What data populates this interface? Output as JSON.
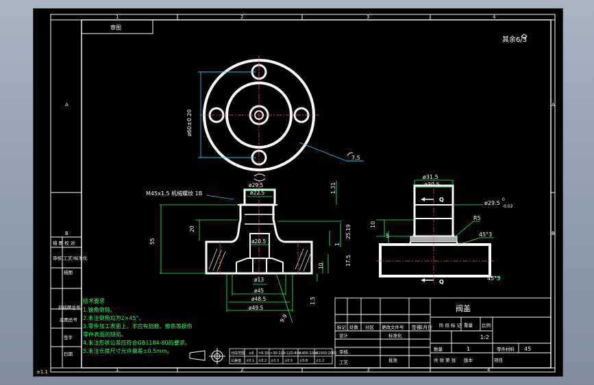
{
  "sheet": {
    "zone_columns": [
      "1",
      "2",
      "3",
      "4"
    ],
    "zone_rows": [
      "A",
      "B"
    ],
    "sheet_count": "其余6/3",
    "scale_note": "±1.1"
  },
  "top_left_box": "审图",
  "left_strip": {
    "labels": [
      "描 图 校 对",
      "审核(工艺)标准化",
      "描图",
      "旧底图总号",
      "底图总号",
      "签字",
      "日期"
    ]
  },
  "views": {
    "top_dia": "ø60±0.20",
    "top_hole": "7.5",
    "thread": "M45x1.5 机械螺纹 1B",
    "front": {
      "dims": [
        "ø29.5",
        "ø22.5",
        "ø20.5",
        "ø13",
        "ø45",
        "ø48.5",
        "ø49.5"
      ],
      "heights": [
        "1.31",
        "20",
        "55",
        "25.19",
        "17.5",
        "1",
        "10",
        "1.5",
        "9.9"
      ]
    },
    "side": {
      "dims": [
        "ø31.5",
        "ø30.5",
        "ø29.5",
        "0",
        "-0.02"
      ],
      "marks": [
        "Q",
        "Q",
        "R5",
        "45°3",
        "45°3",
        "10",
        "5"
      ]
    }
  },
  "tech_requirements": {
    "title": "技术要求",
    "items": [
      "1.锐角倒钝。",
      "2.未注倒角均为2×45°。",
      "3.零件加工表面上，不应有划痕、擦伤等损伤",
      "零件表面的缺陷。",
      "4.未注形状公差应符合GB1184-80的要求。",
      "5.未注长度尺寸允许偏差±0.5mm。"
    ]
  },
  "tolerance_table": {
    "row1": [
      "分段范围",
      "≤6",
      ">6-30",
      ">30-120",
      ">120-400",
      ">400-1000",
      ">1000-2000"
    ],
    "row2": [
      "公差值",
      "±0.1",
      "±0.2",
      "±0.3",
      "±0.5",
      "±0.8",
      "±1.2"
    ]
  },
  "title_block": {
    "part_name": "阀盖",
    "header_cols": [
      "标记",
      "处数",
      "分区",
      "更改文件号",
      "签名",
      "年月日"
    ],
    "roles": [
      "设计",
      "审核",
      "工艺"
    ],
    "role_right": [
      "标准化",
      "批准"
    ],
    "stage_header": [
      "阶 段 标 记",
      "重量",
      "比例"
    ],
    "scale": "1:2",
    "qty_label": "数量",
    "qty": "1",
    "material_label": "零件材料",
    "material": "45",
    "sheet_row": [
      "共 张 第 张",
      "版本",
      "项目"
    ]
  }
}
